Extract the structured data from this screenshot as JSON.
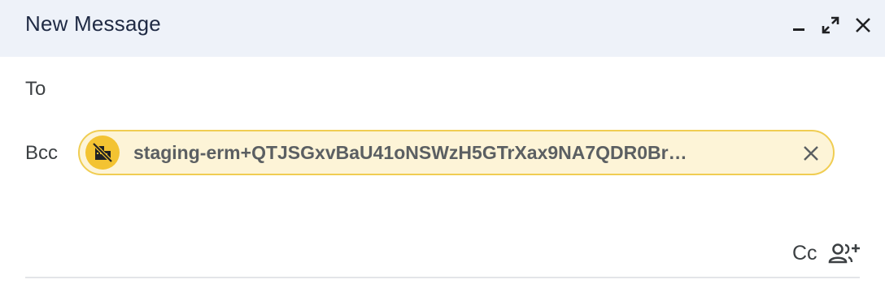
{
  "window": {
    "title": "New Message"
  },
  "recipients": {
    "to_label": "To",
    "bcc_label": "Bcc",
    "bcc_chip": {
      "text": "staging-erm+QTJSGxvBaU41oNSWzH5GTrXax9NA7QDR0Br…",
      "icon": "no-domain-icon",
      "background": "#fdf4d7",
      "border": "#f0cd52",
      "avatar_color": "#f3c332"
    },
    "cc_label": "Cc"
  },
  "icons": {
    "minimize": "minimize-icon",
    "expand": "expand-icon",
    "close": "close-icon",
    "remove_chip": "close-icon",
    "add_people": "person-add-icon"
  },
  "colors": {
    "header_bg": "#eef2f9",
    "title": "#1f2a44"
  }
}
